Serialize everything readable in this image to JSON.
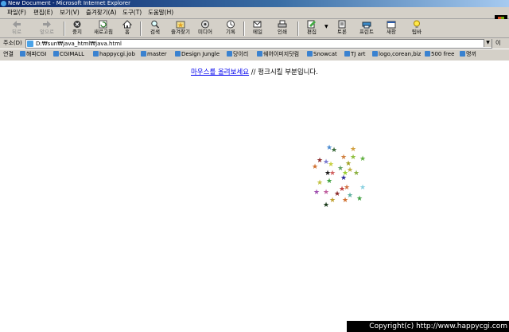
{
  "window": {
    "title": "New Document - Microsoft Internet Explorer"
  },
  "menu": [
    "파일(F)",
    "편집(E)",
    "보기(V)",
    "즐겨찾기(A)",
    "도구(T)",
    "도움말(H)"
  ],
  "toolbar": [
    {
      "label": "뒤로",
      "icon": "back-arrow-icon",
      "disabled": true
    },
    {
      "label": "앞으로",
      "icon": "forward-arrow-icon",
      "disabled": true
    },
    {
      "label": "중지",
      "icon": "stop-icon"
    },
    {
      "label": "새로고침",
      "icon": "refresh-icon"
    },
    {
      "label": "홈",
      "icon": "home-icon"
    },
    {
      "label": "검색",
      "icon": "search-icon"
    },
    {
      "label": "즐겨찾기",
      "icon": "favorites-icon"
    },
    {
      "label": "미디어",
      "icon": "media-icon"
    },
    {
      "label": "기록",
      "icon": "history-icon"
    },
    {
      "label": "메일",
      "icon": "mail-icon"
    },
    {
      "label": "인쇄",
      "icon": "print-icon"
    },
    {
      "label": "편집",
      "icon": "edit-icon"
    },
    {
      "label": "토론",
      "icon": "discuss-icon"
    },
    {
      "label": "프린트",
      "icon": "printer-icon"
    },
    {
      "label": "새창",
      "icon": "new-window-icon"
    },
    {
      "label": "팁바",
      "icon": "lightbulb-icon"
    }
  ],
  "address": {
    "label": "주소(D)",
    "value": "D:₩sun₩java_html₩java.html",
    "go": "이"
  },
  "links": {
    "label": "연결",
    "items": [
      "해피CGI",
      "CGIMALL",
      "happycgi.job",
      "master",
      "Design Jungle",
      "당이리",
      "쉐어이미지닷컴",
      "Snowcat",
      "TJ art",
      "logo,corean,biz",
      "500 free",
      "명끼"
    ]
  },
  "page": {
    "link_text": "마우스를 올려보세요",
    "rest_text": " // 펑크시킬 부분입니다."
  },
  "stars": {
    "glyph": "★"
  },
  "footer": {
    "copyright": "Copyright(c) http://www.happycgi.com"
  }
}
